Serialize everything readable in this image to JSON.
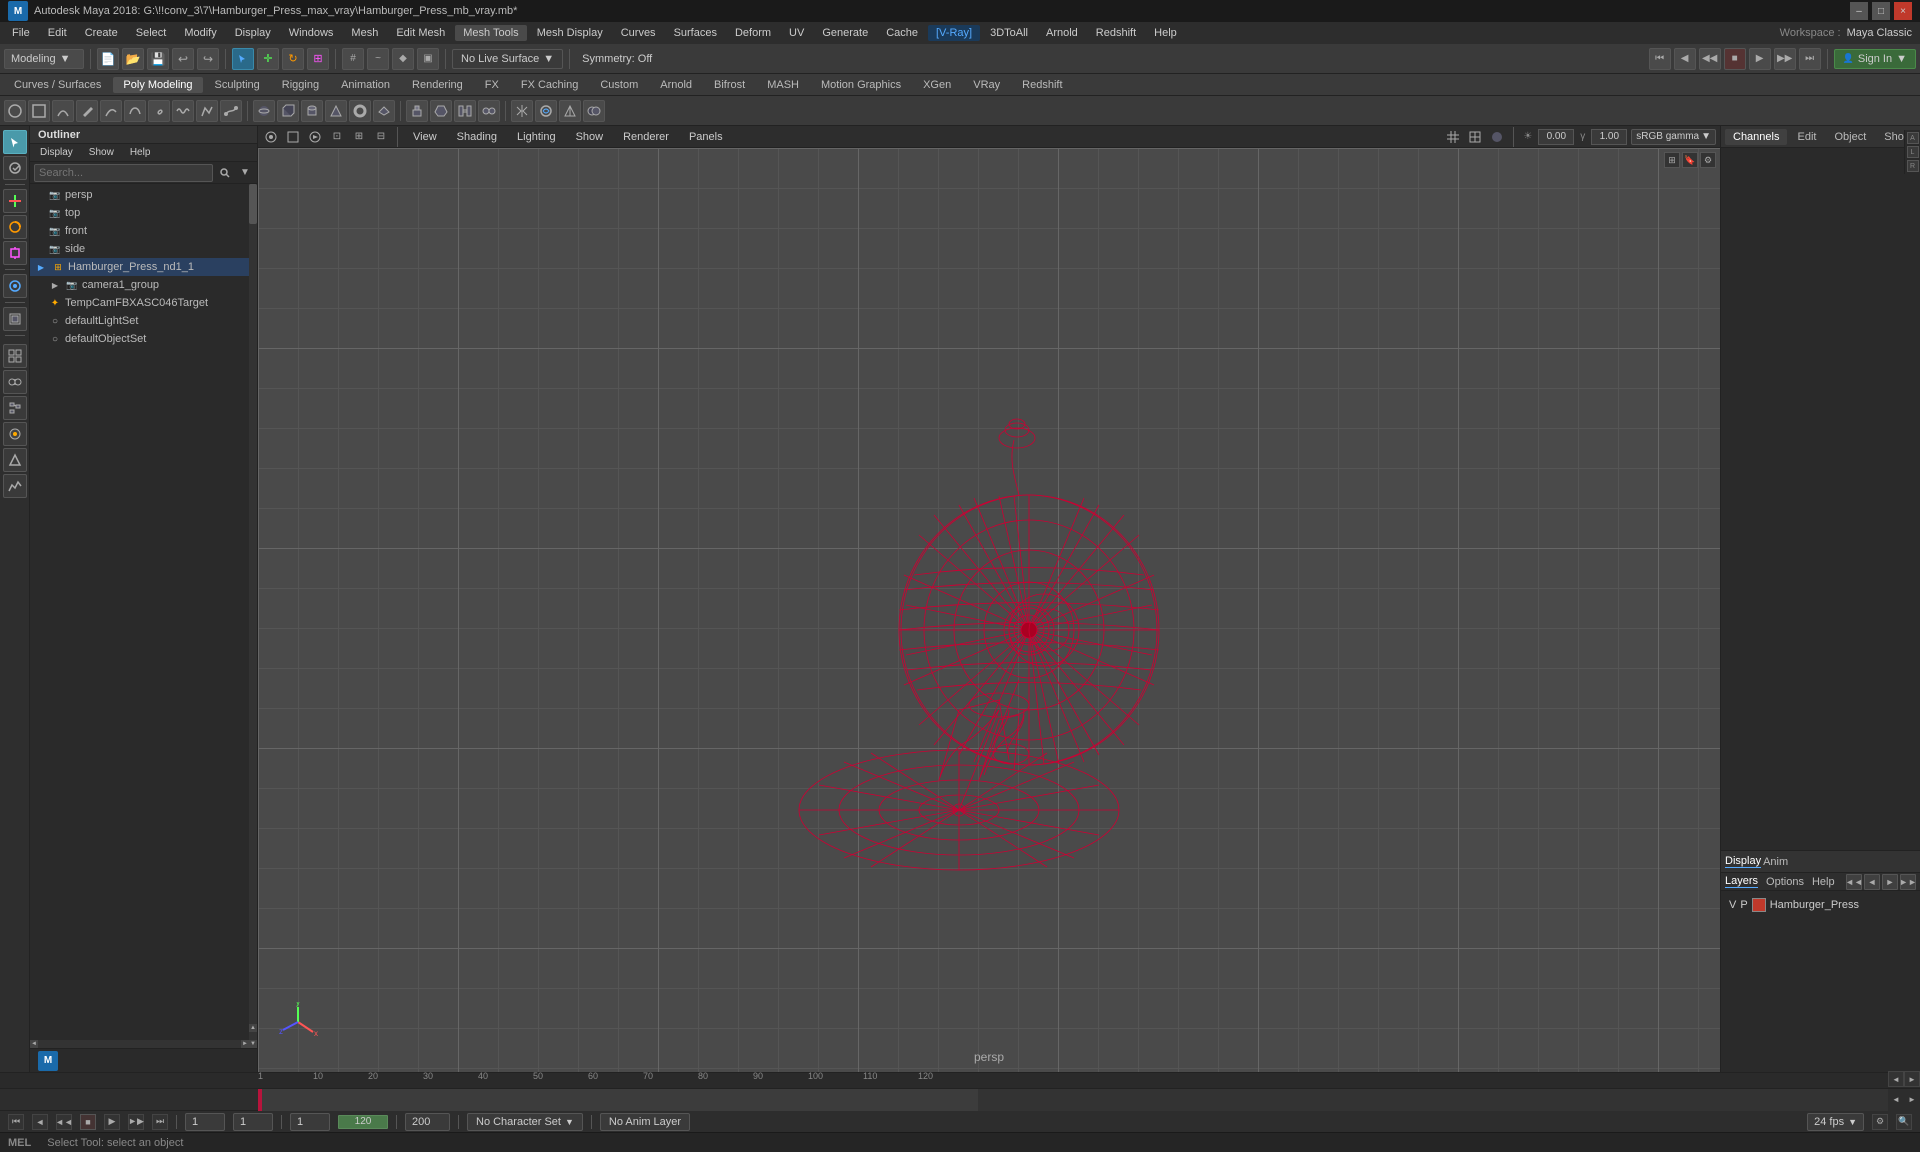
{
  "window": {
    "title": "Autodesk Maya 2018: G:\\!!conv_3\\7\\Hamburger_Press_max_vray\\Hamburger_Press_mb_vray.mb*",
    "min_label": "–",
    "max_label": "□",
    "close_label": "×"
  },
  "menu": {
    "items": [
      "File",
      "Edit",
      "Create",
      "Select",
      "Modify",
      "Display",
      "Windows",
      "Mesh",
      "Edit Mesh",
      "Mesh Tools",
      "Mesh Display",
      "Curves",
      "Surfaces",
      "Deform",
      "UV",
      "Generate",
      "Cache",
      "V-Ray",
      "3DtoAll",
      "Arnold",
      "Redshift",
      "Help"
    ]
  },
  "toolbar": {
    "workspace_label": "Workspace :",
    "workspace_value": "Maya Classic",
    "modeling_label": "Modeling",
    "no_live_surface": "No Live Surface",
    "symmetry_off": "Symmetry: Off",
    "sign_in": "Sign In"
  },
  "tabs": {
    "items": [
      "Curves / Surfaces",
      "Poly Modeling",
      "Sculpting",
      "Rigging",
      "Animation",
      "Rendering",
      "FX",
      "FX Caching",
      "Custom",
      "Arnold",
      "Bifrost",
      "MASH",
      "Motion Graphics",
      "XGen",
      "VRay",
      "Redshift"
    ]
  },
  "outliner": {
    "title": "Outliner",
    "menu_items": [
      "Display",
      "Show",
      "Help"
    ],
    "search_placeholder": "Search...",
    "items": [
      {
        "label": "persp",
        "type": "cam",
        "indent": 1
      },
      {
        "label": "top",
        "type": "cam",
        "indent": 1
      },
      {
        "label": "front",
        "type": "cam",
        "indent": 1
      },
      {
        "label": "side",
        "type": "cam",
        "indent": 1
      },
      {
        "label": "Hamburger_Press_nd1_1",
        "type": "grp",
        "indent": 0
      },
      {
        "label": "camera1_group",
        "type": "grp",
        "indent": 1
      },
      {
        "label": "TempCamFBXASC046Target",
        "type": "star",
        "indent": 1
      },
      {
        "label": "defaultLightSet",
        "type": "set",
        "indent": 0
      },
      {
        "label": "defaultObjectSet",
        "type": "set",
        "indent": 0
      }
    ]
  },
  "viewport": {
    "menu_items": [
      "View",
      "Shading",
      "Lighting",
      "Show",
      "Renderer",
      "Panels"
    ],
    "camera_label": "persp",
    "gamma_label": "sRGB gamma",
    "value1": "0.00",
    "value2": "1.00",
    "label": "persp"
  },
  "right_panel": {
    "tabs": [
      "Channels",
      "Edit",
      "Object",
      "Show"
    ],
    "display_tabs": [
      "Display",
      "Anim"
    ],
    "layer_tabs": [
      "Layers",
      "Options",
      "Help"
    ],
    "layer_controls": [
      "◄◄",
      "◄",
      "►",
      "►►"
    ],
    "layer": {
      "v_label": "V",
      "p_label": "P",
      "name": "Hamburger_Press"
    }
  },
  "timeline": {
    "marks": [
      "1",
      "10",
      "20",
      "30",
      "40",
      "50",
      "60",
      "70",
      "80",
      "90",
      "100",
      "110",
      "120"
    ],
    "mark_positions": [
      0,
      55,
      110,
      165,
      220,
      275,
      330,
      385,
      440,
      495,
      550,
      605,
      660
    ],
    "start": "1",
    "end": "120",
    "current": "1",
    "playback_end": "120",
    "range_end": "200",
    "fps": "24 fps"
  },
  "status_bar": {
    "current_frame_label": "1",
    "sub_frame": "1",
    "frame_display": "1",
    "playback_end": "120",
    "animation_end": "200",
    "no_character_set": "No Character Set",
    "no_anim_layer": "No Anim Layer",
    "fps_value": "24 fps"
  },
  "cmd_bar": {
    "mel_label": "MEL",
    "status_text": "Select Tool: select an object"
  },
  "icons": {
    "search": "🔍",
    "camera": "📷",
    "group": "▶",
    "set": "○",
    "light": "💡",
    "expand": "▶",
    "collapse": "▼"
  }
}
